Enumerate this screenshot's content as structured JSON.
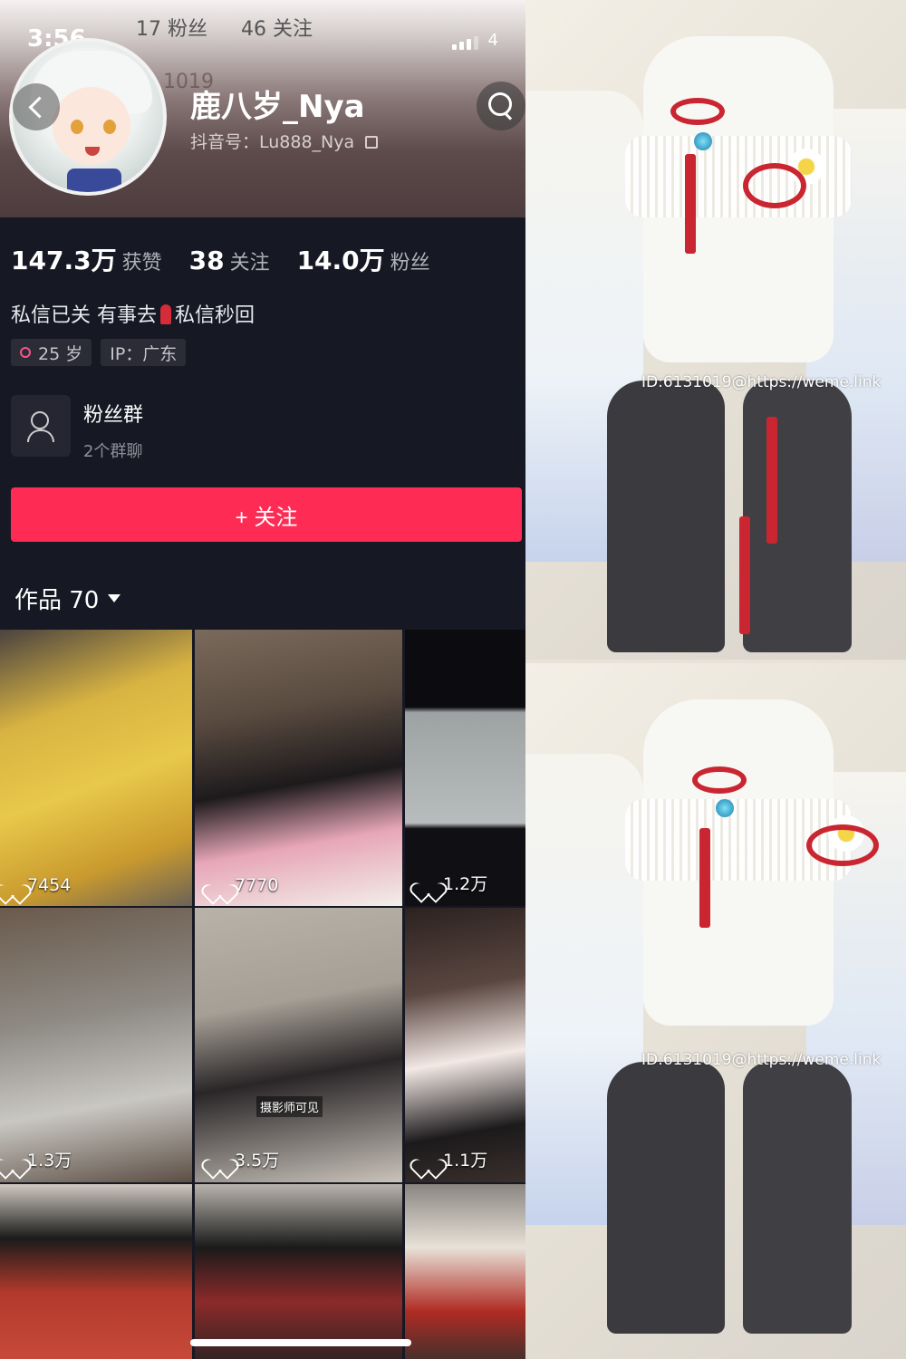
{
  "status_bar": {
    "time": "3:56",
    "battery": "4"
  },
  "ghost_header": {
    "fans": "17 粉丝",
    "following": "46 关注",
    "id_fragment": "1019"
  },
  "profile": {
    "name": "鹿八岁_Nya",
    "douyin_id": "抖音号：Lu888_Nya",
    "stats": [
      {
        "value": "147.3万",
        "label": "获赞"
      },
      {
        "value": "38",
        "label": "关注"
      },
      {
        "value": "14.0万",
        "label": "粉丝"
      }
    ],
    "bio_before": "私信已关 有事去",
    "bio_after": "私信秒回",
    "tags": {
      "age": "25 岁",
      "ip": "IP：广东"
    },
    "fan_group": {
      "title": "粉丝群",
      "subtitle": "2个群聊"
    },
    "follow_button": "+ 关注",
    "works_tab": "作品 70"
  },
  "colors": {
    "background": "#161823",
    "follow": "#fe2c55",
    "tag_bg": "#2b2c36"
  },
  "videos": [
    {
      "likes": "7454",
      "caption": ""
    },
    {
      "likes": "7770",
      "caption": ""
    },
    {
      "likes": "1.2万",
      "caption": ""
    },
    {
      "likes": "1.3万",
      "caption": ""
    },
    {
      "likes": "3.5万",
      "caption": "摄影师可见"
    },
    {
      "likes": "1.1万",
      "caption": ""
    },
    {
      "likes": "",
      "caption": ""
    },
    {
      "likes": "",
      "caption": ""
    },
    {
      "likes": "",
      "caption": ""
    }
  ],
  "photos": {
    "watermark_1": "ID:6131019@https://weme.link",
    "watermark_2": "ID:6131019@https://weme.link"
  }
}
